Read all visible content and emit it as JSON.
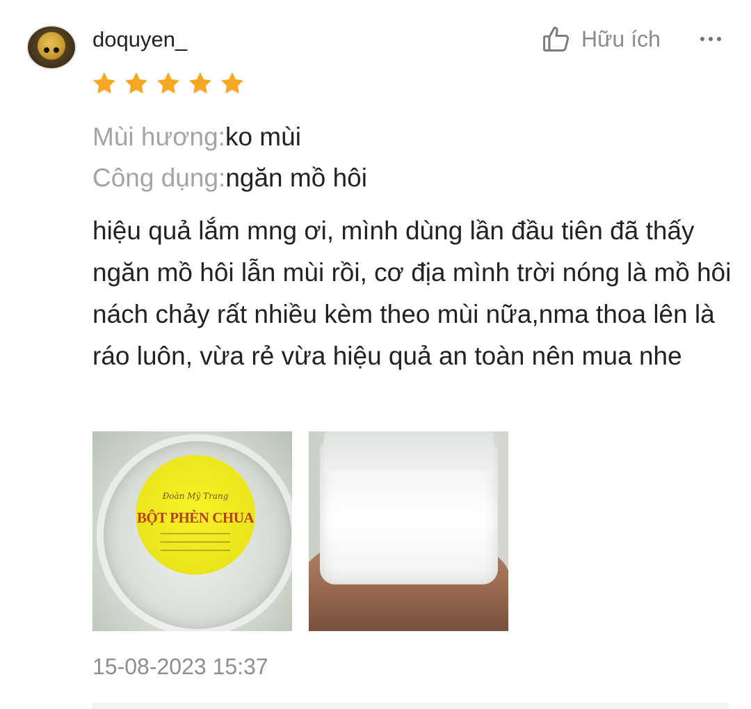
{
  "review": {
    "username": "doquyen_",
    "rating": 5,
    "helpful_label": "Hữu ích",
    "attributes": [
      {
        "label": "Mùi hương:",
        "value": "ko mùi"
      },
      {
        "label": "Công dụng:",
        "value": "ngăn mồ hôi"
      }
    ],
    "text": "hiệu quả lắm mng ơi, mình dùng lần đầu tiên đã thấy ngăn mồ hôi lẫn mùi rồi, cơ địa mình trời nóng là mồ hôi nách chảy rất nhiều kèm theo mùi nữa,nma thoa lên là ráo luôn, vừa rẻ vừa hiệu quả an toàn nên mua nhe",
    "photos": [
      {
        "sticker_brand": "Đoàn Mỹ Trang",
        "sticker_title": "BỘT PHÈN CHUA"
      },
      {}
    ],
    "timestamp": "15-08-2023 15:37"
  },
  "colors": {
    "star": "#f5a623",
    "label_gray": "#a4a4a4",
    "text": "#222222",
    "muted": "#8e8e8e"
  },
  "icons": {
    "helpful": "thumbs-up-icon",
    "more": "more-options-icon",
    "star": "star-icon"
  }
}
